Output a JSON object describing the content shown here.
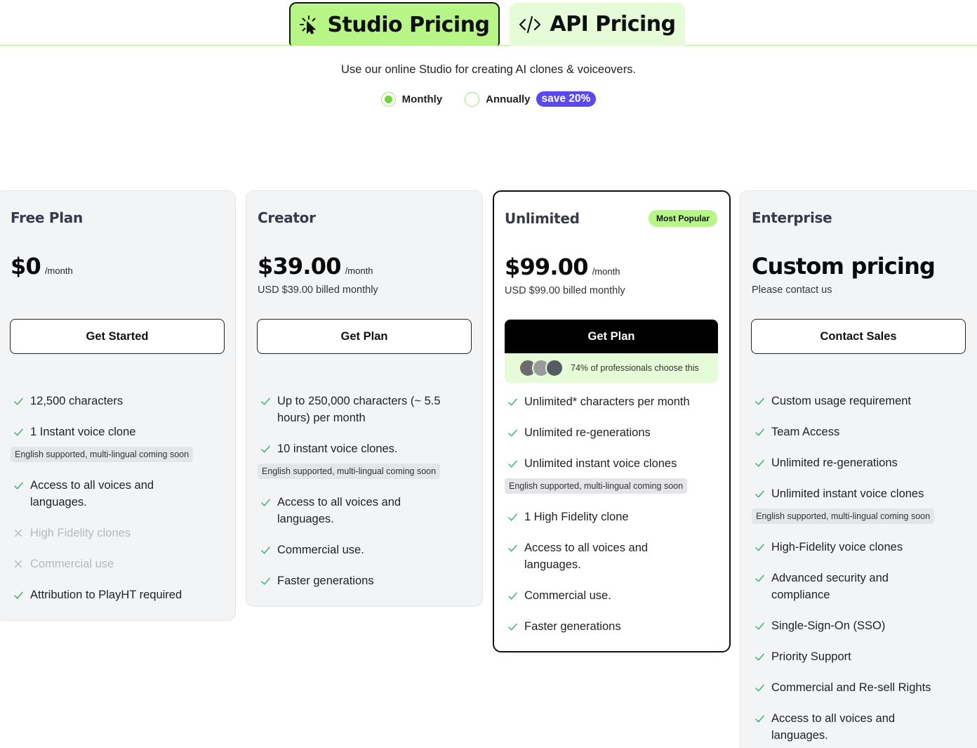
{
  "tabs": [
    {
      "label": "Studio Pricing",
      "icon": "cursor-click-icon",
      "active": true
    },
    {
      "label": "API Pricing",
      "icon": "code-icon",
      "active": false
    }
  ],
  "header": {
    "subtitle": "Use our online Studio for creating AI clones & voiceovers.",
    "billing": {
      "monthly": "Monthly",
      "annually": "Annually",
      "save_badge": "save 20%",
      "selected": "Monthly"
    }
  },
  "plans": {
    "free": {
      "name": "Free Plan",
      "price": "$0",
      "per": "/month",
      "button": "Get Started",
      "features": [
        "12,500 characters",
        "1 Instant voice clone",
        "Access to all voices and languages.",
        "High Fidelity clones",
        "Commercial use",
        "Attribution to PlayHT required"
      ],
      "note": "English supported, multi-lingual coming soon"
    },
    "creator": {
      "name": "Creator",
      "price": "$39.00",
      "per": "/month",
      "billed": "USD $39.00 billed monthly",
      "button": "Get Plan",
      "features": [
        "Up to 250,000 characters (~ 5.5 hours) per month",
        "10 instant voice clones.",
        "Access to all voices and languages.",
        "Commercial use.",
        "Faster generations"
      ],
      "note": "English supported, multi-lingual coming soon"
    },
    "unlimited": {
      "name": "Unlimited",
      "badge": "Most Popular",
      "price": "$99.00",
      "per": "/month",
      "billed": "USD $99.00 billed monthly",
      "button": "Get Plan",
      "professionals": "74% of professionals choose this",
      "features": [
        "Unlimited* characters per month",
        "Unlimited re-generations",
        "Unlimited instant voice clones",
        "1 High Fidelity clone",
        "Access to all voices and languages.",
        "Commercial use.",
        "Faster generations"
      ],
      "note": "English supported, multi-lingual coming soon"
    },
    "enterprise": {
      "name": "Enterprise",
      "price": "Custom pricing",
      "billed": "Please contact us",
      "button": "Contact Sales",
      "features": [
        "Custom usage requirement",
        "Team Access",
        "Unlimited re-generations",
        "Unlimited instant voice clones",
        "High-Fidelity voice clones",
        "Advanced security and compliance",
        "Single-Sign-On (SSO)",
        "Priority Support",
        "Commercial and Re-sell Rights",
        "Access to all voices and languages."
      ],
      "note": "English supported, multi-lingual coming soon"
    }
  },
  "colors": {
    "accent_green": "#b8f587",
    "light_green": "#e6fbd7",
    "check_green": "#3cb371",
    "badge_purple": "#5b48f0"
  }
}
